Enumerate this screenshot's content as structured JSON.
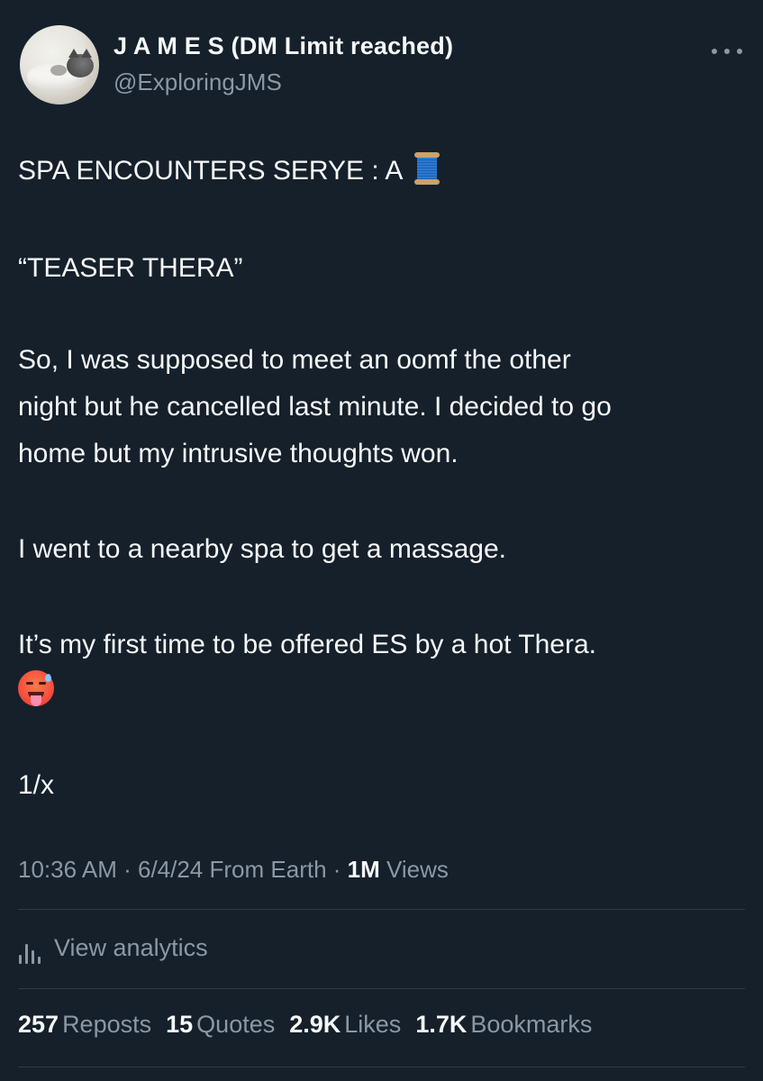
{
  "author": {
    "name": "J A M E S (DM Limit reached)",
    "handle": "@ExploringJMS"
  },
  "tweet": {
    "line1": "SPA ENCOUNTERS SERYE : A",
    "line1_emoji": "spool-of-thread",
    "line2": "“TEASER THERA”",
    "line3": "So, I was supposed to meet an oomf the other",
    "line4": "night but he cancelled last minute. I decided to go",
    "line5": "home but my intrusive thoughts won.",
    "line6": "I went to a nearby spa to get a massage.",
    "line7": "It’s my first time to be offered ES by a hot Thera.",
    "line8_emoji": "hot-face",
    "line9": "1/x"
  },
  "meta": {
    "time": "10:36 AM",
    "date": "6/4/24",
    "source": "From Earth",
    "views_count": "1M",
    "views_label": "Views"
  },
  "analytics": {
    "label": "View analytics"
  },
  "stats": [
    {
      "count": "257",
      "label": "Reposts"
    },
    {
      "count": "15",
      "label": "Quotes"
    },
    {
      "count": "2.9K",
      "label": "Likes"
    },
    {
      "count": "1.7K",
      "label": "Bookmarks"
    }
  ],
  "colors": {
    "background": "#15202b",
    "text_primary": "#f7f9f9",
    "text_secondary": "#8b98a5",
    "divider": "#2f3b47"
  }
}
